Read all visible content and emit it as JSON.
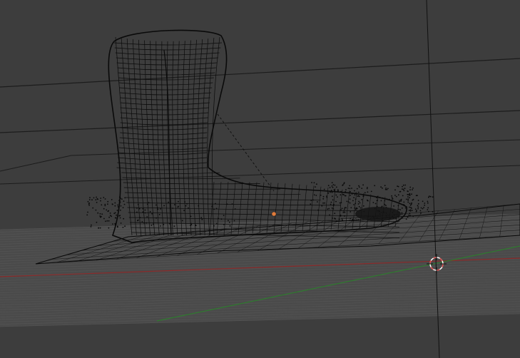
{
  "app": {
    "name": "3D Viewport"
  },
  "viewport": {
    "background_color": "#3d3d3d",
    "grid_color": "#2f2f2f",
    "floor_color": "#4a4a4a",
    "floor_line_color": "#565656",
    "wire_color": "#0a0a0a",
    "x_axis_color": "#8a2a2a",
    "y_axis_color": "#2f7a2f",
    "origin_color": "#e07b3a",
    "cursor_primary_color": "#d84a4a",
    "cursor_secondary_color": "#ffffff"
  },
  "scene": {
    "objects": [
      {
        "name": "boot-mesh",
        "display": "wireframe"
      },
      {
        "name": "point-cloud",
        "display": "points"
      },
      {
        "name": "ground-plane",
        "display": "wireframe"
      }
    ],
    "icons": {
      "origin": "object-origin-dot",
      "cursor": "3d-cursor-crosshair"
    }
  }
}
